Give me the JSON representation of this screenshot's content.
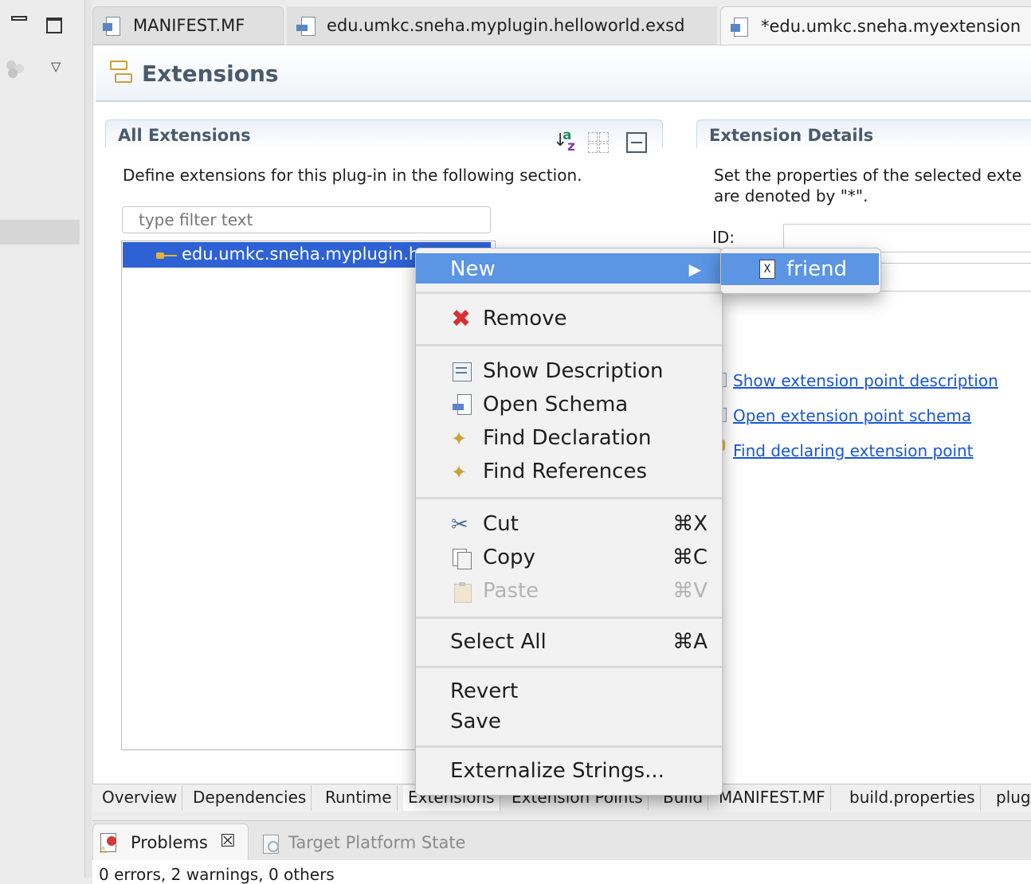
{
  "editor_tabs": [
    {
      "label": "MANIFEST.MF"
    },
    {
      "label": "edu.umkc.sneha.myplugin.helloworld.exsd"
    },
    {
      "label": "*edu.umkc.sneha.myextension"
    }
  ],
  "form": {
    "title": "Extensions"
  },
  "all_extensions": {
    "title": "All Extensions",
    "description": "Define extensions for this plug-in in the following section.",
    "filter_placeholder": "type filter text",
    "tree_item": "edu.umkc.sneha.myplugin.h"
  },
  "extension_details": {
    "title": "Extension Details",
    "description_line1": "Set the properties of the selected exte",
    "description_line2": "are denoted by \"*\".",
    "id_label": "ID:",
    "links": [
      "Show extension point description",
      "Open extension point schema",
      "Find declaring extension point"
    ]
  },
  "context_menu": {
    "new": "New",
    "remove": "Remove",
    "show_description": "Show Description",
    "open_schema": "Open Schema",
    "find_declaration": "Find Declaration",
    "find_references": "Find References",
    "cut": "Cut",
    "cut_shortcut": "⌘X",
    "copy": "Copy",
    "copy_shortcut": "⌘C",
    "paste": "Paste",
    "paste_shortcut": "⌘V",
    "select_all": "Select All",
    "select_all_shortcut": "⌘A",
    "revert": "Revert",
    "save": "Save",
    "externalize": "Externalize Strings..."
  },
  "submenu": {
    "friend": "friend"
  },
  "bottom_tabs": [
    "Overview",
    "Dependencies",
    "Runtime",
    "Extensions",
    "Extension Points",
    "Build",
    "MANIFEST.MF",
    "build.properties",
    "plug"
  ],
  "views": {
    "problems": "Problems",
    "target_platform": "Target Platform State",
    "summary": "0 errors, 2 warnings, 0 others"
  },
  "colors": {
    "selection": "#2e62d4",
    "menu_highlight": "#5b95e4",
    "link": "#1a56d6",
    "header_text": "#4a5a6d"
  }
}
